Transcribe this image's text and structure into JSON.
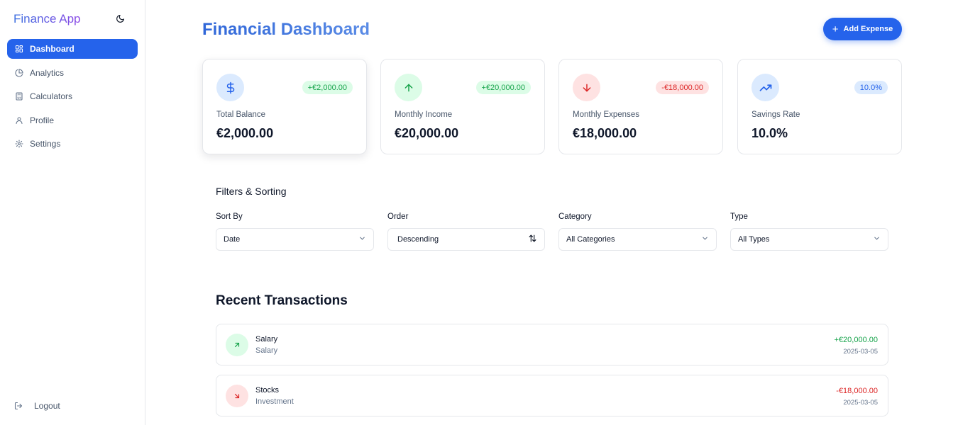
{
  "app": {
    "name": "Finance App"
  },
  "colors": {
    "primary": "#2563eb",
    "income": "#16a34a",
    "expense": "#dc2626",
    "income_bg": "#dcfce7",
    "expense_bg": "#fee2e2",
    "info_bg": "#dbeafe"
  },
  "sidebar": {
    "theme_icon": "moon-icon",
    "items": [
      {
        "label": "Dashboard",
        "icon": "layout-grid-icon",
        "active": true
      },
      {
        "label": "Analytics",
        "icon": "pie-chart-icon",
        "active": false
      },
      {
        "label": "Calculators",
        "icon": "calculator-icon",
        "active": false
      },
      {
        "label": "Profile",
        "icon": "user-icon",
        "active": false
      },
      {
        "label": "Settings",
        "icon": "gear-icon",
        "active": false
      }
    ],
    "logout_label": "Logout",
    "logout_icon": "logout-icon"
  },
  "header": {
    "title": "Financial Dashboard",
    "add_button_label": "Add Expense"
  },
  "stats": [
    {
      "label": "Total Balance",
      "value": "€2,000.00",
      "badge": "+€2,000.00",
      "icon": "dollar-icon"
    },
    {
      "label": "Monthly Income",
      "value": "€20,000.00",
      "badge": "+€20,000.00",
      "icon": "arrow-up-icon"
    },
    {
      "label": "Monthly Expenses",
      "value": "€18,000.00",
      "badge": "-€18,000.00",
      "icon": "arrow-down-icon"
    },
    {
      "label": "Savings Rate",
      "value": "10.0%",
      "badge": "10.0%",
      "icon": "trending-up-icon"
    }
  ],
  "filters": {
    "title": "Filters & Sorting",
    "sort_by": {
      "label": "Sort By",
      "value": "Date"
    },
    "order": {
      "label": "Order",
      "value": "Descending"
    },
    "category": {
      "label": "Category",
      "value": "All Categories"
    },
    "type": {
      "label": "Type",
      "value": "All Types"
    }
  },
  "transactions": {
    "title": "Recent Transactions",
    "items": [
      {
        "name": "Salary",
        "category": "Salary",
        "amount": "+€20,000.00",
        "date": "2025-03-05",
        "kind": "income"
      },
      {
        "name": "Stocks",
        "category": "Investment",
        "amount": "-€18,000.00",
        "date": "2025-03-05",
        "kind": "expense"
      }
    ]
  }
}
